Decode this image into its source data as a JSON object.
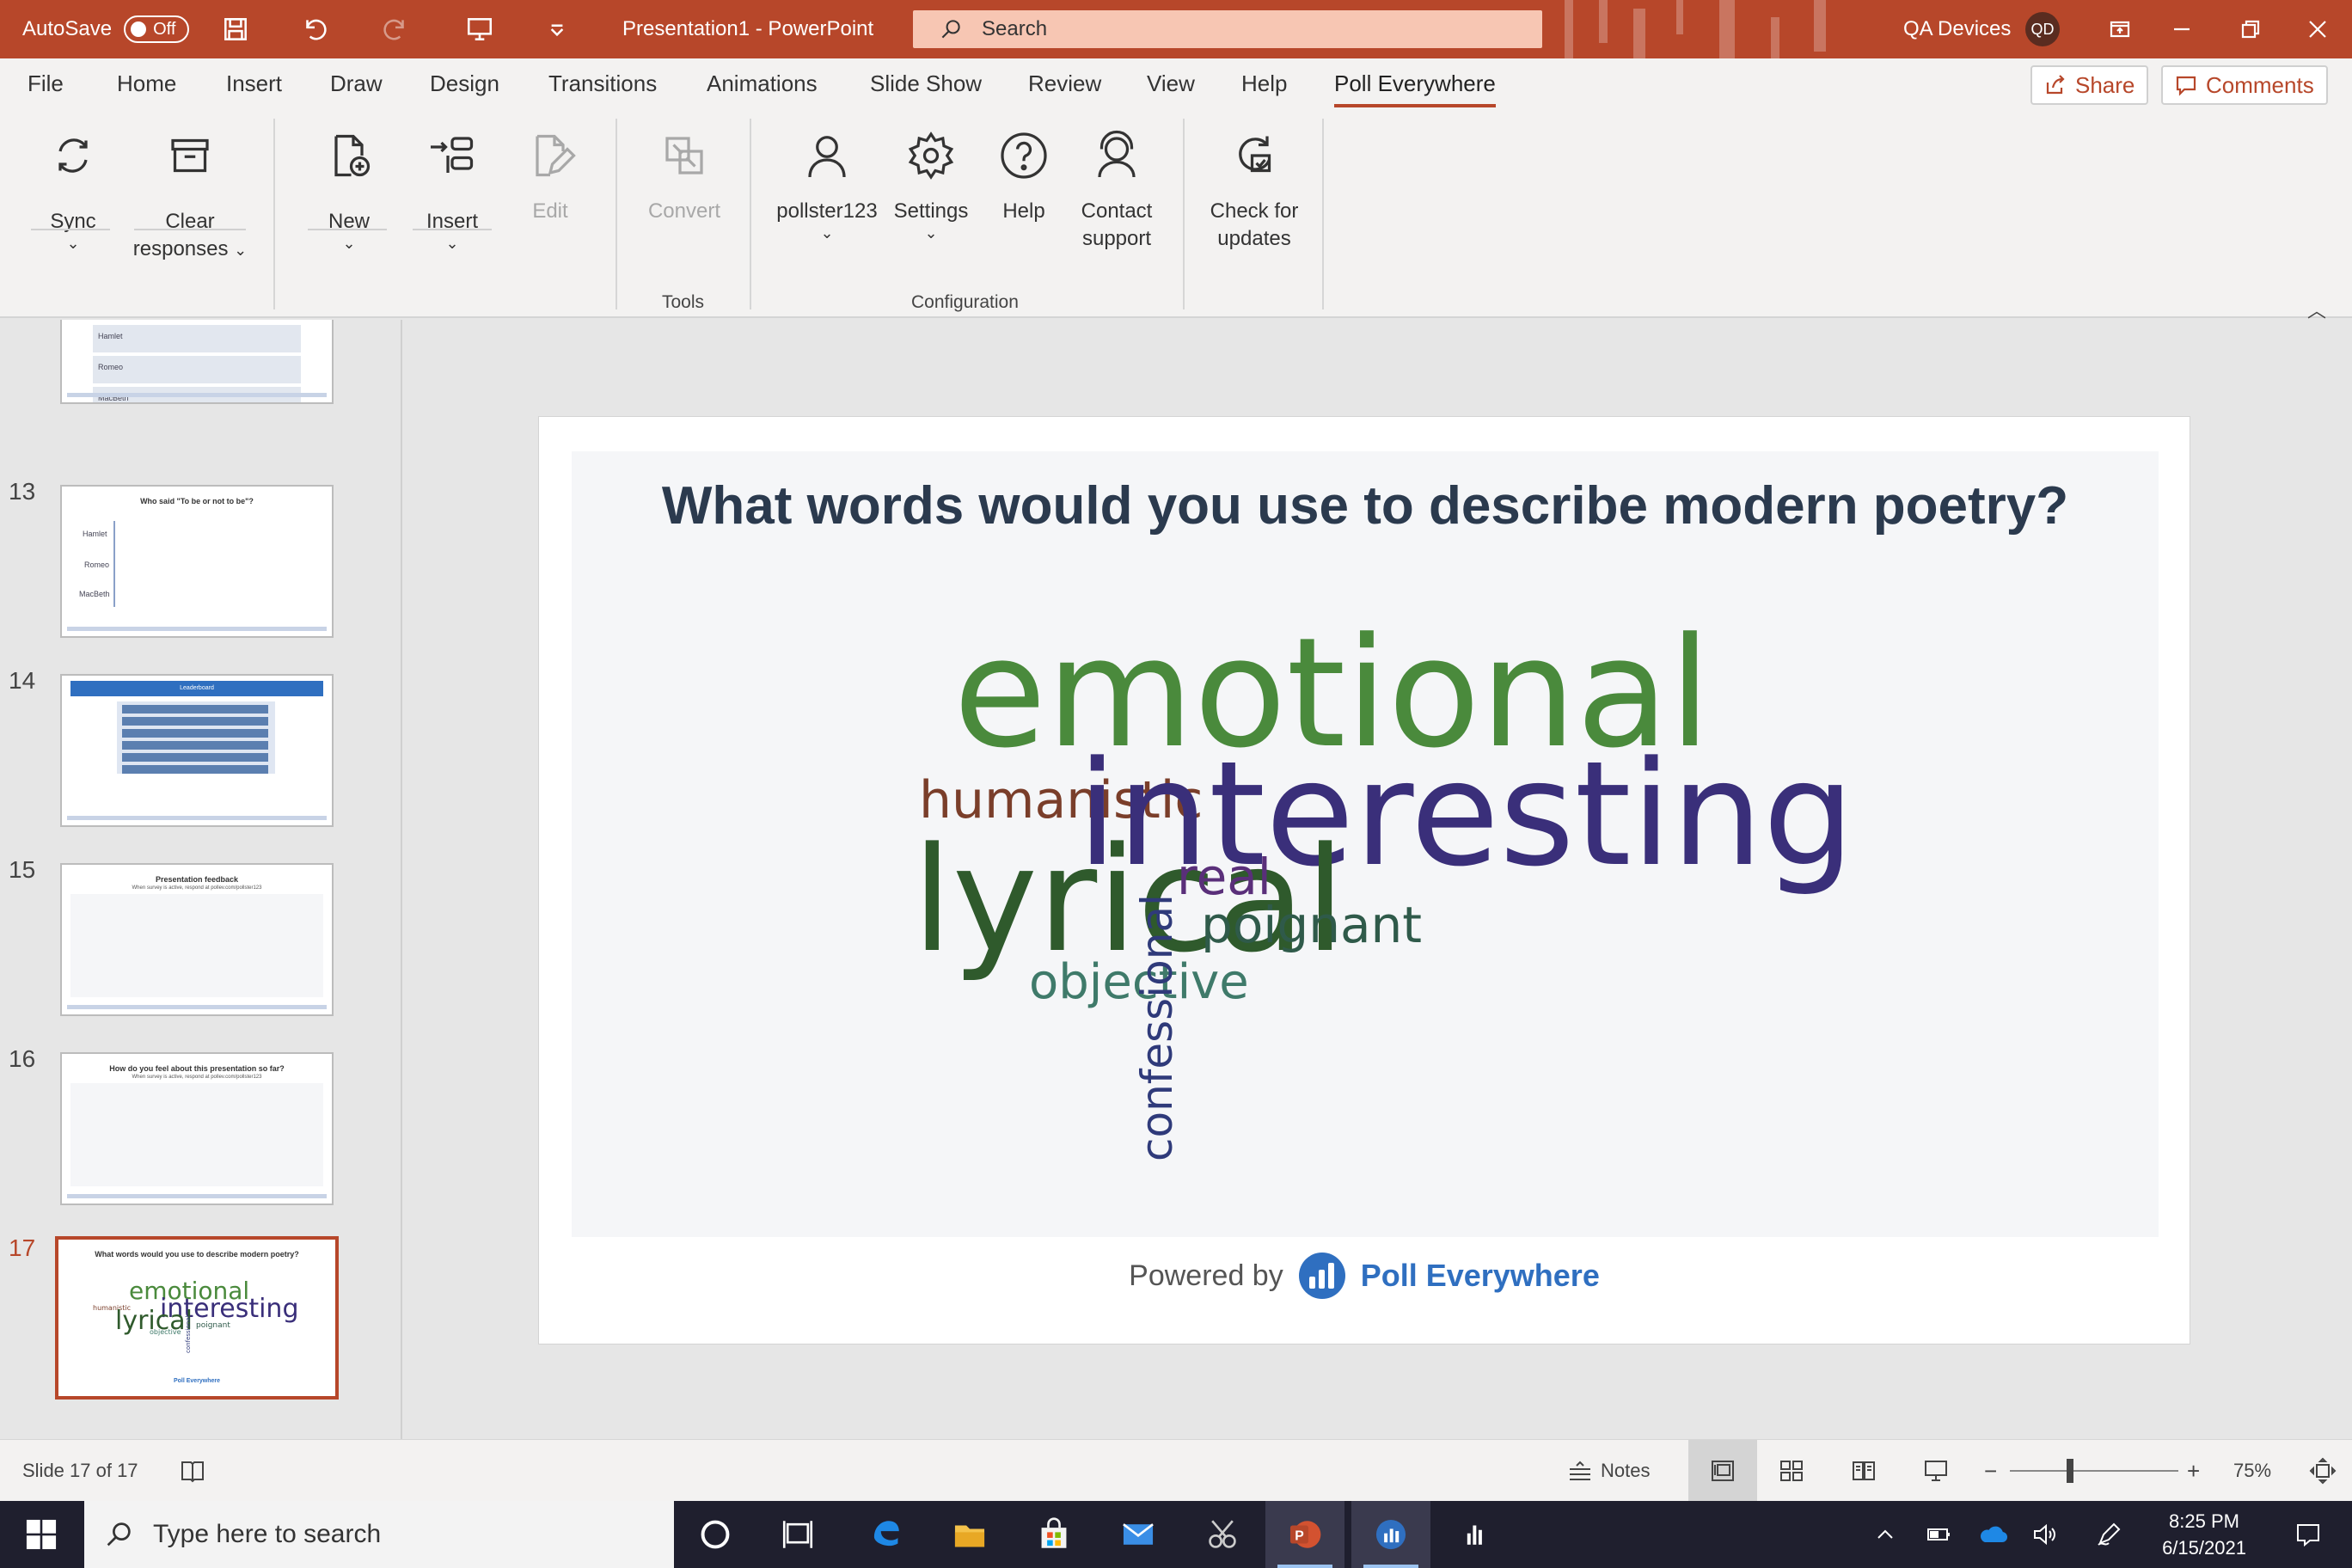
{
  "titlebar": {
    "autosave_label": "AutoSave",
    "autosave_state": "Off",
    "document_title": "Presentation1  -  PowerPoint",
    "search_placeholder": "Search",
    "user_name": "QA Devices",
    "user_initials": "QD",
    "accent": "#b7472a"
  },
  "menu": {
    "tabs": [
      "File",
      "Home",
      "Insert",
      "Draw",
      "Design",
      "Transitions",
      "Animations",
      "Slide Show",
      "Review",
      "View",
      "Help",
      "Poll Everywhere"
    ],
    "active_tab": "Poll Everywhere",
    "share": "Share",
    "comments": "Comments"
  },
  "ribbon": {
    "sync": "Sync",
    "clear_1": "Clear",
    "clear_2": "responses",
    "new": "New",
    "insert": "Insert",
    "edit": "Edit",
    "convert": "Convert",
    "tools_group": "Tools",
    "account": "pollster123",
    "settings": "Settings",
    "help": "Help",
    "contact_1": "Contact",
    "contact_2": "support",
    "updates_1": "Check for",
    "updates_2": "updates",
    "configuration_group": "Configuration"
  },
  "thumbnails": {
    "slide12_options": [
      "Hamlet",
      "Romeo",
      "MacBeth"
    ],
    "slide13": {
      "number": "13",
      "title": "Who said \"To be or not to be\"?",
      "options": [
        "Hamlet",
        "Romeo",
        "MacBeth"
      ]
    },
    "slide14": {
      "number": "14",
      "title": "Leaderboard"
    },
    "slide15": {
      "number": "15",
      "title": "Presentation feedback",
      "sub": "When survey is active, respond at pollev.com/pollster123"
    },
    "slide16": {
      "number": "16",
      "title": "How do you feel about this presentation so far?",
      "sub": "When survey is active, respond at pollev.com/pollster123"
    },
    "slide17": {
      "number": "17",
      "title": "What words would you use to describe modern poetry?"
    }
  },
  "slide": {
    "question": "What words would you use to describe modern poetry?",
    "words": {
      "emotional": "emotional",
      "humanistic": "humanistic",
      "interesting": "interesting",
      "lyrical": "lyrical",
      "real": "real",
      "poignant": "poignant",
      "objective": "objective",
      "confessional": "confessional"
    },
    "colors": {
      "emotional": "#4a8a3c",
      "humanistic": "#7a3e2a",
      "interesting": "#3a2f7a",
      "lyrical": "#2f5a2c",
      "real": "#5a2f7a",
      "poignant": "#2f5a4a",
      "objective": "#3f7a6a",
      "confessional": "#2f3a7a"
    },
    "powered_by": "Powered by",
    "brand": "Poll Everywhere"
  },
  "statusbar": {
    "slide_counter": "Slide 17 of 17",
    "notes": "Notes",
    "zoom": "75%"
  },
  "taskbar": {
    "search_placeholder": "Type here to search",
    "time": "8:25 PM",
    "date": "6/15/2021"
  }
}
